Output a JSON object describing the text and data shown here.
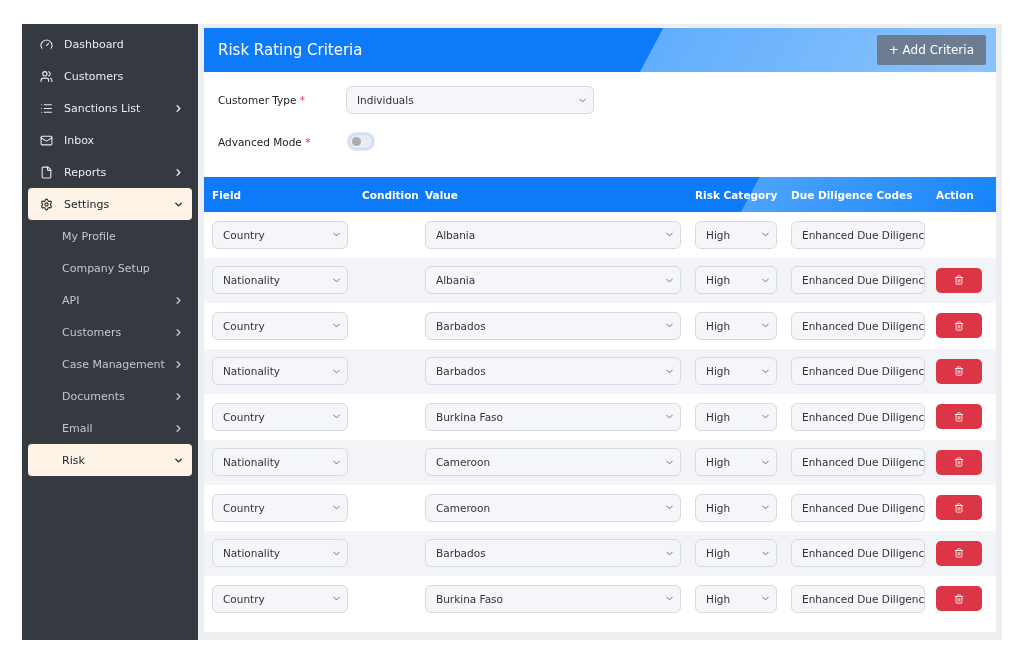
{
  "sidebar": {
    "items": [
      {
        "label": "Dashboard",
        "selected": false
      },
      {
        "label": "Customers",
        "selected": false
      },
      {
        "label": "Sanctions List",
        "selected": false,
        "expanded": false
      },
      {
        "label": "Inbox",
        "selected": false
      },
      {
        "label": "Reports",
        "selected": false,
        "expanded": false
      },
      {
        "label": "Settings",
        "selected": true,
        "expanded": true,
        "children": [
          {
            "label": "My Profile",
            "selected": false
          },
          {
            "label": "Company Setup",
            "selected": false
          },
          {
            "label": "API",
            "selected": false,
            "expanded": false
          },
          {
            "label": "Customers",
            "selected": false,
            "expanded": false
          },
          {
            "label": "Case Management",
            "selected": false,
            "expanded": false
          },
          {
            "label": "Documents",
            "selected": false,
            "expanded": false
          },
          {
            "label": "Email",
            "selected": false,
            "expanded": false
          },
          {
            "label": "Risk",
            "selected": true,
            "expanded": true
          }
        ]
      }
    ]
  },
  "panel": {
    "title": "Risk Rating Criteria",
    "add_button": "+ Add Criteria",
    "customer_type": {
      "label": "Customer Type",
      "required_mark": "*",
      "value": "Individuals"
    },
    "advanced_mode": {
      "label": "Advanced Mode",
      "required_mark": "*",
      "on": false
    }
  },
  "table": {
    "columns": [
      "Field",
      "Condition",
      "Value",
      "Risk Category",
      "Due Diligence Codes",
      "Action"
    ],
    "rows": [
      {
        "field": "Country",
        "value": "Albania",
        "risk": "High",
        "codes": "Enhanced Due Diligenc",
        "removable": false
      },
      {
        "field": "Nationality",
        "value": "Albania",
        "risk": "High",
        "codes": "Enhanced Due Diligenc",
        "removable": true
      },
      {
        "field": "Country",
        "value": "Barbados",
        "risk": "High",
        "codes": "Enhanced Due Diligenc",
        "removable": true
      },
      {
        "field": "Nationality",
        "value": "Barbados",
        "risk": "High",
        "codes": "Enhanced Due Diligenc",
        "removable": true
      },
      {
        "field": "Country",
        "value": "Burkina Faso",
        "risk": "High",
        "codes": "Enhanced Due Diligenc",
        "removable": true
      },
      {
        "field": "Nationality",
        "value": "Cameroon",
        "risk": "High",
        "codes": "Enhanced Due Diligenc",
        "removable": true
      },
      {
        "field": "Country",
        "value": "Cameroon",
        "risk": "High",
        "codes": "Enhanced Due Diligenc",
        "removable": true
      },
      {
        "field": "Nationality",
        "value": "Barbados",
        "risk": "High",
        "codes": "Enhanced Due Diligenc",
        "removable": true
      },
      {
        "field": "Country",
        "value": "Burkina Faso",
        "risk": "High",
        "codes": "Enhanced Due Diligenc",
        "removable": true
      }
    ]
  }
}
